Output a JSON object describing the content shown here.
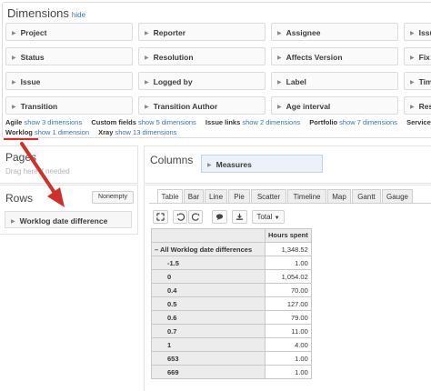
{
  "dimensions": {
    "title": "Dimensions",
    "hide_link": "hide",
    "rows": [
      [
        "Project",
        "Reporter",
        "Assignee",
        "Issu"
      ],
      [
        "Status",
        "Resolution",
        "Affects Version",
        "Fix V"
      ],
      [
        "Issue",
        "Logged by",
        "Label",
        "Time"
      ],
      [
        "Transition",
        "Transition Author",
        "Age interval",
        "Rese"
      ]
    ]
  },
  "legend": {
    "line1": [
      {
        "category": "Agile",
        "link": "show 3 dimensions"
      },
      {
        "category": "Custom fields",
        "link": "show 5 dimensions"
      },
      {
        "category": "Issue links",
        "link": "show 2 dimensions"
      },
      {
        "category": "Portfolio",
        "link": "show 7 dimensions"
      },
      {
        "category": "Service Des",
        "link": ""
      }
    ],
    "line2": [
      {
        "category": "Worklog",
        "link": "show 1 dimension"
      },
      {
        "category": "Xray",
        "link": "show 13 dimensions"
      }
    ]
  },
  "pages": {
    "title": "Pages",
    "hint": "Drag here if needed"
  },
  "rows_section": {
    "title": "Rows",
    "nonempty_label": "Nonempty",
    "chip_label": "Worklog date difference"
  },
  "columns": {
    "title": "Columns",
    "chip_label": "Measures"
  },
  "tabs": [
    "Table",
    "Bar",
    "Line",
    "Pie",
    "Scatter",
    "Timeline",
    "Map",
    "Gantt",
    "Gauge"
  ],
  "active_tab": "Table",
  "toolbar": {
    "total_label": "Total"
  },
  "table": {
    "column_header": "Hours spent",
    "rows": [
      {
        "label": "All Worklog date differences",
        "value": "1,348.52",
        "expanded": true
      },
      {
        "label": "-1.5",
        "value": "1.00"
      },
      {
        "label": "0",
        "value": "1,054.02"
      },
      {
        "label": "0.4",
        "value": "70.00"
      },
      {
        "label": "0.5",
        "value": "127.00"
      },
      {
        "label": "0.6",
        "value": "79.00"
      },
      {
        "label": "0.7",
        "value": "11.00"
      },
      {
        "label": "1",
        "value": "4.00"
      },
      {
        "label": "653",
        "value": "1.00"
      },
      {
        "label": "669",
        "value": "1.00"
      }
    ]
  },
  "colors": {
    "link": "#3572b0",
    "annotation": "#d0302a",
    "measures_chip": "#ebf2f9"
  }
}
